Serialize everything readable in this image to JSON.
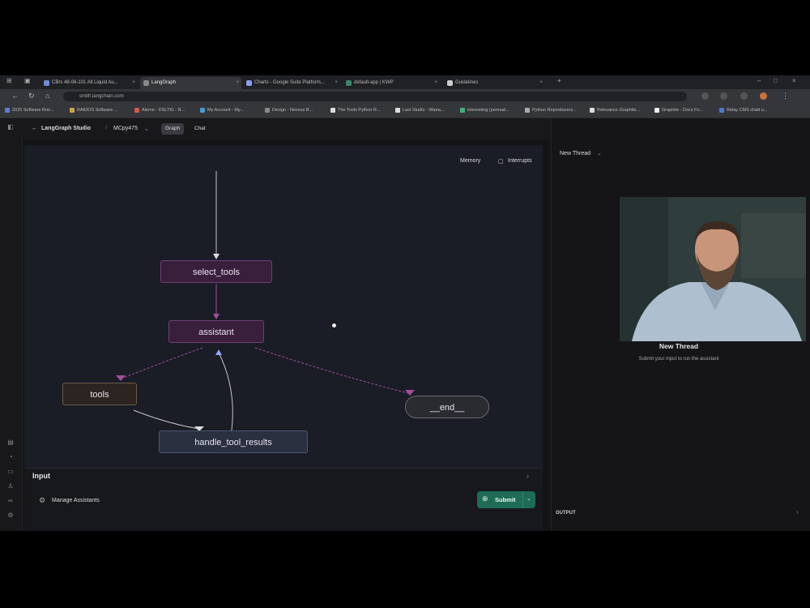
{
  "browser": {
    "tabs": [
      {
        "label": "CBrs 48-06-101 All Liquid Au...",
        "fav": "#6f8bd6"
      },
      {
        "label": "LangGraph",
        "fav": "#8a8a8a"
      },
      {
        "label": "Charts - Google Suite Platform...",
        "fav": "#8d9cf0"
      },
      {
        "label": "default-app | KWP",
        "fav": "#3a8a6a"
      },
      {
        "label": "Guidelines",
        "fav": "#cccccc"
      }
    ],
    "url": "smith.langchain.com",
    "bookmarks": [
      {
        "label": "2025 Software Roo...",
        "fav": "#5b7fd0"
      },
      {
        "label": "RAIDOS Software ...",
        "fav": "#c9a24a"
      },
      {
        "label": "Alerne - DSLTKI - N...",
        "fav": "#d05b4a"
      },
      {
        "label": "My Account - My...",
        "fav": "#4a9ad0"
      },
      {
        "label": "Design - Nexxus B...",
        "fav": "#888888"
      },
      {
        "label": "The Tools Python R...",
        "fav": "#dddddd"
      },
      {
        "label": "Last Studio - Wazw...",
        "fav": "#dddddd"
      },
      {
        "label": "interesting (peresat...",
        "fav": "#3fb07a"
      },
      {
        "label": "Python Reproducers...",
        "fav": "#aaaaaa"
      },
      {
        "label": "Relevance Graphite...",
        "fav": "#dddddd"
      },
      {
        "label": "Graphite - Docs Fo...",
        "fav": "#eeeeee"
      },
      {
        "label": "Relay CMS chatt u...",
        "fav": "#4a7ad0"
      }
    ]
  },
  "app": {
    "product": "LangGraph Studio",
    "graph_selector": "MCpy475",
    "tabs": [
      "Graph",
      "Chat"
    ],
    "active_tab": "Graph",
    "controls": {
      "memory": "Memory",
      "interrupts": "Interrupts"
    },
    "nodes": {
      "select_tools": "select_tools",
      "assistant": "assistant",
      "tools": "tools",
      "handle_tool_results": "handle_tool_results",
      "end": "__end__"
    },
    "input_label": "Input",
    "manage_assistants": "Manage Assistants",
    "submit": "Submit"
  },
  "thread": {
    "selector": "New Thread",
    "title": "New Thread",
    "subtitle": "Submit your input to run the assistant",
    "output_label": "OUTPUT"
  },
  "colors": {
    "accent_green": "#1f6b55",
    "node_purple": "#3a1f3d",
    "edge_purple": "#a0509a"
  }
}
